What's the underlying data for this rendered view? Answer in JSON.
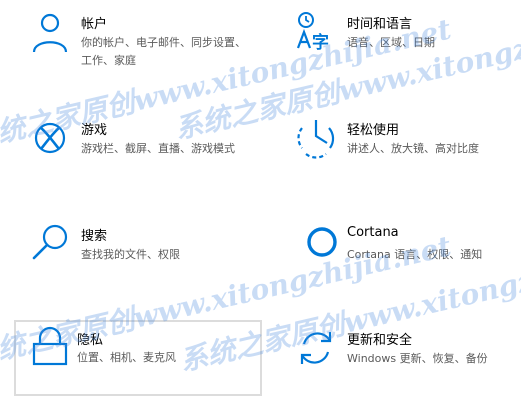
{
  "settings_tiles": [
    {
      "title": "帐户",
      "description": "你的帐户、电子邮件、同步设置、工作、家庭",
      "icon": "person-icon"
    },
    {
      "title": "时间和语言",
      "description": "语音、区域、日期",
      "icon": "time-language-icon"
    },
    {
      "title": "游戏",
      "description": "游戏栏、截屏、直播、游戏模式",
      "icon": "xbox-icon"
    },
    {
      "title": "轻松使用",
      "description": "讲述人、放大镜、高对比度",
      "icon": "ease-of-access-icon"
    },
    {
      "title": "搜索",
      "description": "查找我的文件、权限",
      "icon": "search-icon"
    },
    {
      "title": "Cortana",
      "description": "Cortana 语言、权限、通知",
      "icon": "cortana-icon"
    },
    {
      "title": "隐私",
      "description": "位置、相机、麦克风",
      "icon": "lock-icon"
    },
    {
      "title": "更新和安全",
      "description": "Windows 更新、恢复、备份",
      "icon": "update-sync-icon"
    }
  ],
  "accent_color": "#0078d7",
  "watermark": {
    "text": "系统之家原创www.xitongzhijia.net"
  }
}
